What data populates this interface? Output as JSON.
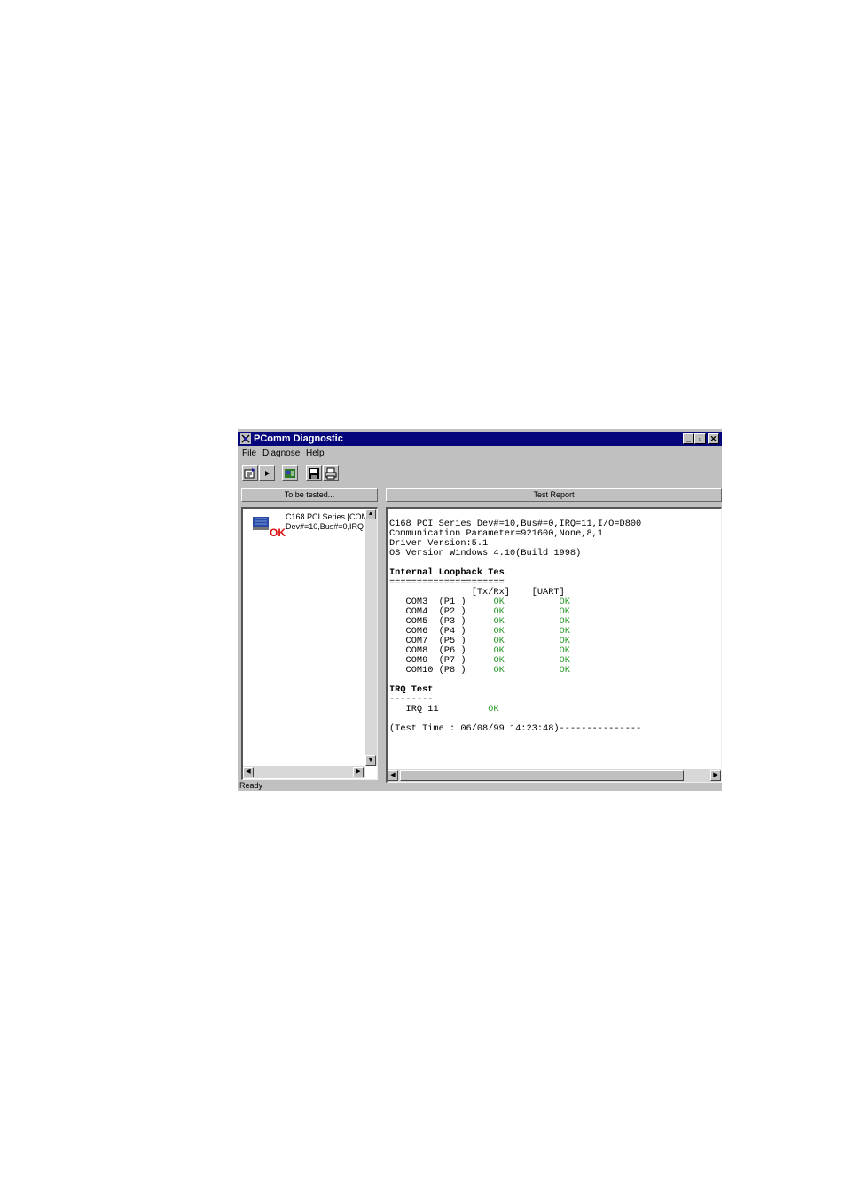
{
  "window": {
    "title": "PComm Diagnostic",
    "controls": [
      "_",
      "▫",
      "✕"
    ]
  },
  "menu": [
    "File",
    "Diagnose",
    "Help"
  ],
  "toolbar": {
    "icons": [
      "open-config-icon",
      "run-icon",
      "diagnose-icon",
      "save-icon",
      "print-icon"
    ]
  },
  "left_pane": {
    "header": "To be tested...",
    "item": {
      "line1": "C168 PCI Series  [COM",
      "line2": "Dev#=10,Bus#=0,IRQ",
      "status": "OK"
    }
  },
  "right_pane": {
    "header": "Test Report",
    "info": [
      "C168 PCI Series Dev#=10,Bus#=0,IRQ=11,I/O=D800",
      "Communication Parameter=921600,None,8,1",
      "Driver Version:5.1",
      "OS Version Windows 4.10(Build 1998)"
    ],
    "loopback_title": "Internal Loopback Tes",
    "loopback_underline": "=====================",
    "columns": [
      "[Tx/Rx]",
      "[UART]"
    ],
    "ports": [
      {
        "com": "COM3",
        "port": "(P1 )",
        "txrx": "OK",
        "uart": "OK"
      },
      {
        "com": "COM4",
        "port": "(P2 )",
        "txrx": "OK",
        "uart": "OK"
      },
      {
        "com": "COM5",
        "port": "(P3 )",
        "txrx": "OK",
        "uart": "OK"
      },
      {
        "com": "COM6",
        "port": "(P4 )",
        "txrx": "OK",
        "uart": "OK"
      },
      {
        "com": "COM7",
        "port": "(P5 )",
        "txrx": "OK",
        "uart": "OK"
      },
      {
        "com": "COM8",
        "port": "(P6 )",
        "txrx": "OK",
        "uart": "OK"
      },
      {
        "com": "COM9",
        "port": "(P7 )",
        "txrx": "OK",
        "uart": "OK"
      },
      {
        "com": "COM10",
        "port": "(P8 )",
        "txrx": "OK",
        "uart": "OK"
      }
    ],
    "irq_title": "IRQ Test",
    "irq_underline": "--------",
    "irq_label": "IRQ 11",
    "irq_result": "OK",
    "test_time": "(Test Time : 06/08/99 14:23:48)---------------"
  },
  "status_bar": "Ready",
  "colors": {
    "title_bar": "#06067c",
    "ok_green": "#2a9a2a",
    "ok_red": "#dd1111",
    "chrome": "#c0c0c0"
  }
}
